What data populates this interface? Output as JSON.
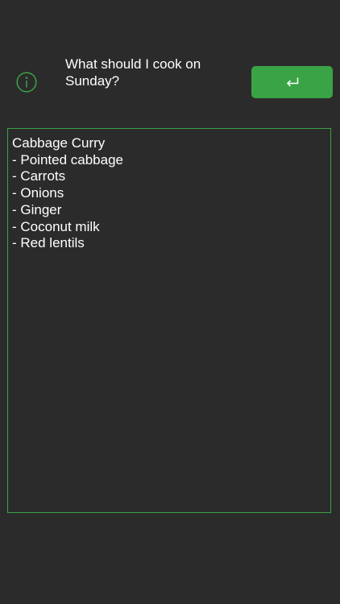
{
  "question": {
    "text": "What should I cook on Sunday?"
  },
  "buttons": {
    "info_icon": "info-circle-icon",
    "submit_icon": "return-arrow-icon"
  },
  "result": {
    "lines": [
      "Cabbage Curry",
      "- Pointed cabbage",
      "- Carrots",
      "- Onions",
      "- Ginger",
      "- Coconut milk",
      "- Red lentils"
    ]
  },
  "colors": {
    "background": "#2b2b2b",
    "accent": "#3aa346",
    "text": "#ffffff"
  }
}
